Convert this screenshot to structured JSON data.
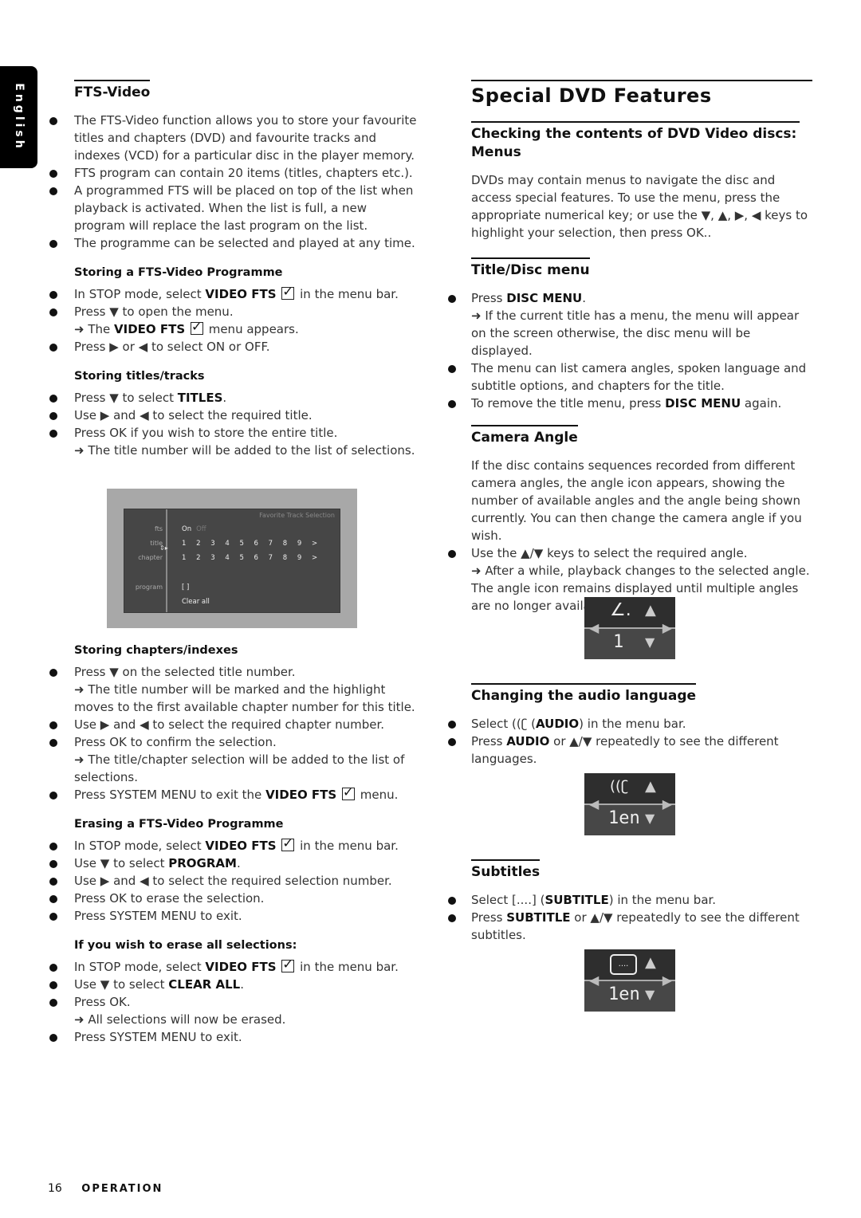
{
  "language_tab": "English",
  "left": {
    "heading": "FTS-Video",
    "intro": [
      "The FTS-Video function allows you to store your favourite titles and chapters (DVD) and favourite tracks and indexes (VCD) for a particular disc in the player memory.",
      "FTS program can contain 20 items (titles, chapters etc.).",
      "A programmed FTS will be placed on top of the list when playback is activated. When the list is full, a new program will replace the last program on the list.",
      "The programme can be selected and played at any time."
    ],
    "storing_programme": {
      "title": "Storing a FTS-Video Programme",
      "items": [
        {
          "pre": "In STOP mode, select ",
          "bold": "VIDEO FTS",
          "post": " in the menu bar."
        },
        {
          "pre": "Press ▼ to open the menu.",
          "bold": "",
          "post": ""
        },
        {
          "pre": "➜ The ",
          "bold": "VIDEO FTS",
          "post": " menu appears."
        },
        {
          "pre": "Press ▶ or ◀  to select ON or OFF.",
          "bold": "",
          "post": ""
        }
      ]
    },
    "storing_titles": {
      "title": "Storing titles/tracks",
      "items": [
        {
          "pre": "Press ▼ to select ",
          "bold": "TITLES",
          "post": "."
        },
        {
          "pre": "Use ▶ and ◀ to select the required title.",
          "bold": "",
          "post": ""
        },
        {
          "pre": "Press OK if you wish to store the entire title.",
          "bold": "",
          "post": ""
        },
        {
          "pre": "➜ The title number will be added to the list of selections.",
          "bold": "",
          "post": ""
        }
      ]
    },
    "osd": {
      "title": "Favorite Track Selection",
      "labels": {
        "fts": "fts",
        "title": "title",
        "chapter": "chapter",
        "program": "program"
      },
      "fts_on": "On",
      "fts_off": "Off",
      "title_numbers": "1 2 3 4 5 6 7 8 9 >",
      "chapter_numbers": "1 2 3 4 5 6 7 8 9 >",
      "program_value": "[ ]",
      "clear_all": "Clear all"
    },
    "storing_chapters": {
      "title": "Storing chapters/indexes",
      "items": [
        {
          "pre": "Press ▼ on the selected title number.",
          "bold": "",
          "post": ""
        },
        {
          "pre": "➜ The title number will be marked and the highlight moves to the first available chapter number for this title.",
          "bold": "",
          "post": ""
        },
        {
          "pre": "Use ▶ and ◀ to select the required chapter number.",
          "bold": "",
          "post": ""
        },
        {
          "pre": "Press OK to confirm the selection.",
          "bold": "",
          "post": ""
        },
        {
          "pre": "➜ The title/chapter selection will be added to the list of selections.",
          "bold": "",
          "post": ""
        },
        {
          "pre": "Press SYSTEM MENU to exit the ",
          "bold": "VIDEO FTS",
          "post": " menu."
        }
      ]
    },
    "erasing_programme": {
      "title": "Erasing a FTS-Video Programme",
      "items": [
        {
          "pre": "In STOP mode, select ",
          "bold": "VIDEO FTS",
          "post": " in the menu bar."
        },
        {
          "pre": "Use ▼ to select ",
          "bold": "PROGRAM",
          "post": "."
        },
        {
          "pre": "Use ▶ and ◀ to select the required selection number.",
          "bold": "",
          "post": ""
        },
        {
          "pre": "Press OK to erase the selection.",
          "bold": "",
          "post": ""
        },
        {
          "pre": "Press SYSTEM MENU to exit.",
          "bold": "",
          "post": ""
        }
      ]
    },
    "erase_all": {
      "title": "If you wish to erase all selections:",
      "items": [
        {
          "pre": "In STOP mode, select ",
          "bold": "VIDEO FTS",
          "post": " in the menu bar."
        },
        {
          "pre": "Use ▼ to select ",
          "bold": "CLEAR ALL",
          "post": "."
        },
        {
          "pre": "Press OK.",
          "bold": "",
          "post": ""
        },
        {
          "pre": "➜ All selections will now be erased.",
          "bold": "",
          "post": ""
        },
        {
          "pre": "Press SYSTEM MENU to exit.",
          "bold": "",
          "post": ""
        }
      ]
    }
  },
  "right": {
    "heading": "Special DVD Features",
    "menus": {
      "title": "Checking the contents of DVD Video discs: Menus",
      "text": "DVDs may contain menus to navigate the disc and access special features. To use the menu, press the appropriate numerical key; or use the ▼, ▲, ▶, ◀ keys to highlight your selection, then press OK.."
    },
    "title_disc": {
      "title": "Title/Disc menu",
      "items": [
        {
          "pre": "Press ",
          "bold": "DISC MENU",
          "post": "."
        },
        {
          "pre": "➜ If the current title has a menu, the menu will appear on the screen otherwise, the disc menu will be displayed.",
          "bold": "",
          "post": ""
        },
        {
          "pre": "The menu can list camera angles, spoken language and subtitle options, and chapters for the title.",
          "bold": "",
          "post": ""
        },
        {
          "pre": "To remove the title menu, press ",
          "bold": "DISC MENU",
          "post": " again."
        }
      ]
    },
    "camera": {
      "title": "Camera Angle",
      "text": "If the disc contains sequences recorded from different camera angles, the angle icon appears, showing the number of available angles and the angle being shown currently. You can then change the camera angle if you wish.",
      "items": [
        {
          "pre": "Use the ▲/▼ keys to select the required angle.",
          "bold": "",
          "post": ""
        },
        {
          "pre": "➜ After a while, playback changes to the selected angle. The angle  icon remains displayed until multiple angles are no longer available.",
          "bold": "",
          "post": ""
        }
      ],
      "osd_value": "1"
    },
    "audio": {
      "title": "Changing the audio language",
      "items": [
        {
          "pre": "Select ((ʗ (",
          "bold": "AUDIO",
          "post": ") in the menu bar."
        },
        {
          "pre": "Press ",
          "bold": "AUDIO",
          "post": " or ▲/▼ repeatedly to see the different languages."
        }
      ],
      "osd_value": "1en"
    },
    "subtitles": {
      "title": "Subtitles",
      "items": [
        {
          "pre": "Select [....] (",
          "bold": "SUBTITLE",
          "post": ") in the menu bar."
        },
        {
          "pre": "Press ",
          "bold": "SUBTITLE",
          "post": " or ▲/▼ repeatedly to see the different subtitles."
        }
      ],
      "osd_value": "1en"
    }
  },
  "footer": {
    "page_number": "16",
    "section": "OPERATION"
  }
}
